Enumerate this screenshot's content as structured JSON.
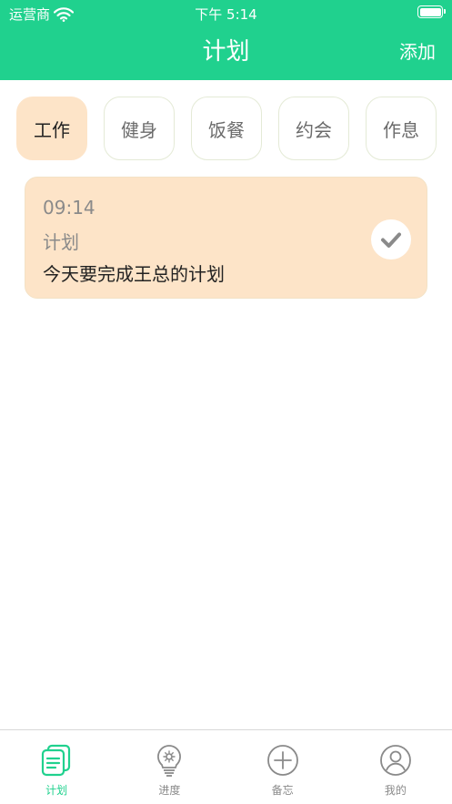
{
  "status_bar": {
    "carrier": "运营商",
    "time": "下午 5:14"
  },
  "nav": {
    "title": "计划",
    "add_label": "添加"
  },
  "categories": [
    {
      "label": "工作",
      "active": true
    },
    {
      "label": "健身",
      "active": false
    },
    {
      "label": "饭餐",
      "active": false
    },
    {
      "label": "约会",
      "active": false
    },
    {
      "label": "作息",
      "active": false
    }
  ],
  "plans": [
    {
      "time": "09:14",
      "category": "计划",
      "content": "今天要完成王总的计划",
      "done": true
    }
  ],
  "tabbar": [
    {
      "label": "计划",
      "icon": "plan-icon",
      "active": true
    },
    {
      "label": "进度",
      "icon": "lightbulb-icon",
      "active": false
    },
    {
      "label": "备忘",
      "icon": "plus-circle-icon",
      "active": false
    },
    {
      "label": "我的",
      "icon": "user-icon",
      "active": false
    }
  ],
  "colors": {
    "brand": "#20d18e",
    "card": "#fde4c8",
    "muted": "#8a8a8a"
  }
}
